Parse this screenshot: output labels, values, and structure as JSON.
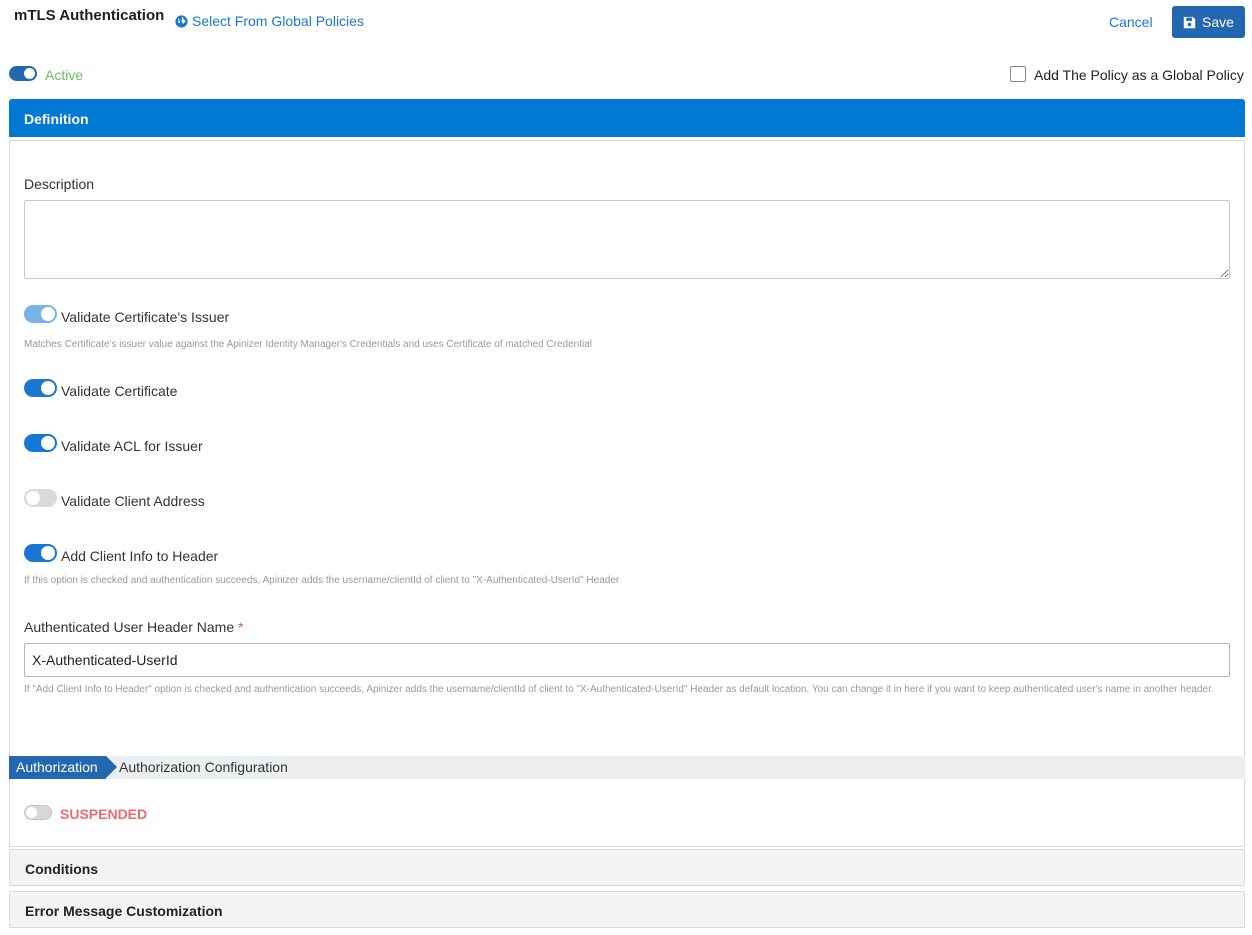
{
  "header": {
    "title": "mTLS Authentication",
    "select_global_label": "Select From Global Policies",
    "cancel_label": "Cancel",
    "save_label": "Save"
  },
  "status": {
    "active_label": "Active",
    "active_on": true,
    "global_policy_label": "Add The Policy as a Global Policy",
    "global_policy_checked": false
  },
  "definition": {
    "header_label": "Definition",
    "description_label": "Description",
    "description_value": "",
    "options": [
      {
        "label": "Validate Certificate's Issuer",
        "on": true,
        "hint": "Matches Certificate's issuer value against the Apinizer Identity Manager's Credentials and uses Certificate of matched Credential"
      },
      {
        "label": "Validate Certificate",
        "on": true
      },
      {
        "label": "Validate ACL for Issuer",
        "on": true
      },
      {
        "label": "Validate Client Address",
        "on": false
      },
      {
        "label": "Add Client Info to Header",
        "on": true,
        "hint": "If this option is checked and authentication succeeds, Apinizer adds the username/clientId of client to \"X-Authenticated-UserId\" Header"
      }
    ],
    "header_name_label": "Authenticated User Header Name",
    "header_name_required": "*",
    "header_name_value": "X-Authenticated-UserId",
    "header_name_hint": "If \"Add Client Info to Header\" option is checked and authentication succeeds, Apinizer adds the username/clientId of client to \"X-Authenticated-UserId\" Header as default location. You can change it in here if you want to keep authenticated user's name in another header."
  },
  "authorization": {
    "tab_label": "Authorization",
    "config_label": "Authorization Configuration",
    "state_label": "SUSPENDED",
    "enabled": false
  },
  "sections": {
    "conditions_label": "Conditions",
    "error_label": "Error Message Customization"
  },
  "colors": {
    "primary": "#0078d4",
    "button": "#2366b1",
    "link": "#1976d2",
    "active_text": "#6cbf5a",
    "suspended_text": "#ef6b6b"
  }
}
